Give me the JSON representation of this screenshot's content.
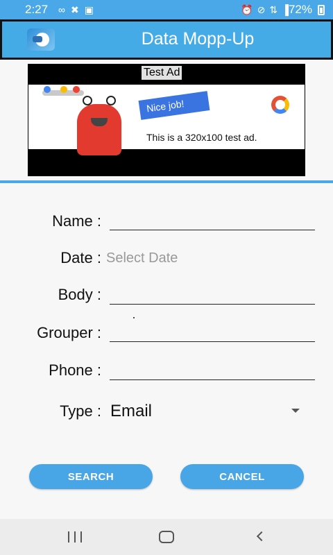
{
  "status_bar": {
    "time": "2:27",
    "battery_text": "72%",
    "battery_level": 0.72,
    "left_icons": [
      "voicemail-icon",
      "missed-call-icon",
      "picture-icon"
    ],
    "right_icons": [
      "alarm-icon",
      "mute-icon",
      "data-icon",
      "signal-icon"
    ]
  },
  "app_bar": {
    "title": "Data Mopp-Up",
    "accent": "#45abe6"
  },
  "ad": {
    "label": "Test Ad",
    "badge": "Nice job!",
    "text": "This is a 320x100 test ad."
  },
  "form": {
    "name_label": "Name :",
    "date_label": "Date :",
    "date_placeholder": "Select Date",
    "body_label": "Body :",
    "grouper_label": "Grouper :",
    "phone_label": "Phone :",
    "type_label": "Type :",
    "type_value": "Email"
  },
  "buttons": {
    "search": "SEARCH",
    "cancel": "CANCEL"
  },
  "nav_bar": {
    "icons": [
      "recent-apps-icon",
      "home-icon",
      "back-icon"
    ]
  }
}
